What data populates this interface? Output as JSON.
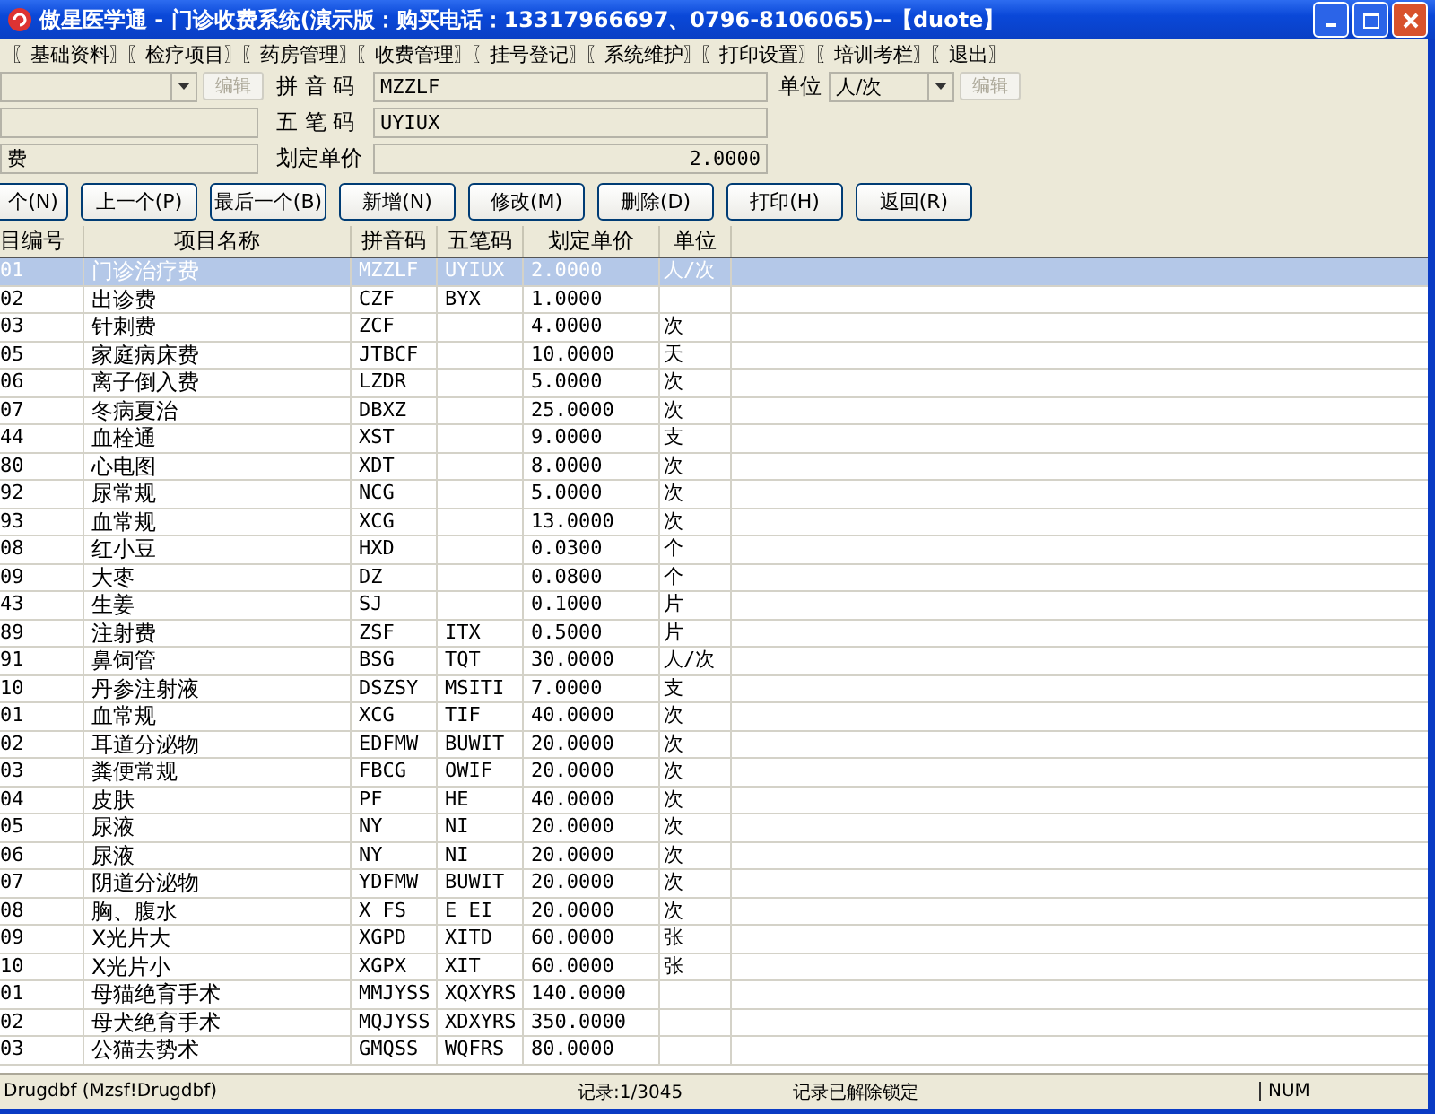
{
  "window": {
    "title": "傲星医学通 - 门诊收费系统(演示版：购买电话：13317966697、0796-8106065)--【duote】"
  },
  "menu": [
    "〖基础资料〗",
    "〖检疗项目〗",
    "〖药房管理〗",
    "〖收费管理〗",
    "〖挂号登记〗",
    "〖系统维护〗",
    "〖打印设置〗",
    "〖培训考栏〗",
    "〖退出〗"
  ],
  "form": {
    "left_fields": [
      {
        "kind": "combo",
        "button": "编辑",
        "disabled": true
      },
      {
        "kind": "text"
      },
      {
        "kind": "text",
        "value": "费"
      }
    ],
    "fields": [
      {
        "label": "拼 音 码",
        "value": "MZZLF",
        "kind": "text"
      },
      {
        "label": "五 笔 码",
        "value": "UYIUX",
        "kind": "text"
      },
      {
        "label": "划定单价",
        "value": "2.0000",
        "kind": "number"
      }
    ],
    "unit": {
      "label": "单位",
      "value": "人/次",
      "button": "编辑",
      "disabled": true
    }
  },
  "buttons": [
    "个(N)",
    "上一个(P)",
    "最后一个(B)",
    "新增(N)",
    "修改(M)",
    "删除(D)",
    "打印(H)",
    "返回(R)"
  ],
  "table": {
    "columns": [
      "目编号",
      "项目名称",
      "拼音码",
      "五笔码",
      "划定单价",
      "单位"
    ],
    "rows": [
      {
        "cells": [
          "01",
          "门诊治疗费",
          "MZZLF",
          "UYIUX",
          "2.0000",
          "人/次"
        ],
        "selected": true
      },
      {
        "cells": [
          "02",
          "出诊费",
          "CZF",
          "BYX",
          "1.0000",
          ""
        ],
        "selected": false
      },
      {
        "cells": [
          "03",
          "针刺费",
          "ZCF",
          "",
          "4.0000",
          "次"
        ],
        "selected": false
      },
      {
        "cells": [
          "05",
          "家庭病床费",
          "JTBCF",
          "",
          "10.0000",
          "天"
        ],
        "selected": false
      },
      {
        "cells": [
          "06",
          "离子倒入费",
          "LZDR",
          "",
          "5.0000",
          "次"
        ],
        "selected": false
      },
      {
        "cells": [
          "07",
          "冬病夏治",
          "DBXZ",
          "",
          "25.0000",
          "次"
        ],
        "selected": false
      },
      {
        "cells": [
          "44",
          "血栓通",
          "XST",
          "",
          "9.0000",
          "支"
        ],
        "selected": false
      },
      {
        "cells": [
          "80",
          "心电图",
          "XDT",
          "",
          "8.0000",
          "次"
        ],
        "selected": false
      },
      {
        "cells": [
          "92",
          "尿常规",
          "NCG",
          "",
          "5.0000",
          "次"
        ],
        "selected": false
      },
      {
        "cells": [
          "93",
          "血常规",
          "XCG",
          "",
          "13.0000",
          "次"
        ],
        "selected": false
      },
      {
        "cells": [
          "08",
          "红小豆",
          "HXD",
          "",
          "0.0300",
          "个"
        ],
        "selected": false
      },
      {
        "cells": [
          "09",
          "大枣",
          "DZ",
          "",
          "0.0800",
          "个"
        ],
        "selected": false
      },
      {
        "cells": [
          "43",
          "生姜",
          "SJ",
          "",
          "0.1000",
          "片"
        ],
        "selected": false
      },
      {
        "cells": [
          "89",
          "注射费",
          "ZSF",
          "ITX",
          "0.5000",
          "片"
        ],
        "selected": false
      },
      {
        "cells": [
          "91",
          "鼻饲管",
          "BSG",
          "TQT",
          "30.0000",
          "人/次"
        ],
        "selected": false
      },
      {
        "cells": [
          "10",
          "丹参注射液",
          "DSZSY",
          "MSITI",
          "7.0000",
          "支"
        ],
        "selected": false
      },
      {
        "cells": [
          "01",
          "血常规",
          "XCG",
          "TIF",
          "40.0000",
          "次"
        ],
        "selected": false
      },
      {
        "cells": [
          "02",
          "耳道分泌物",
          "EDFMW",
          "BUWIT",
          "20.0000",
          "次"
        ],
        "selected": false
      },
      {
        "cells": [
          "03",
          "粪便常规",
          "FBCG",
          "OWIF",
          "20.0000",
          "次"
        ],
        "selected": false
      },
      {
        "cells": [
          "04",
          "皮肤",
          "PF",
          "HE",
          "40.0000",
          "次"
        ],
        "selected": false
      },
      {
        "cells": [
          "05",
          "尿液",
          "NY",
          "NI",
          "20.0000",
          "次"
        ],
        "selected": false
      },
      {
        "cells": [
          "06",
          "尿液",
          "NY",
          "NI",
          "20.0000",
          "次"
        ],
        "selected": false
      },
      {
        "cells": [
          "07",
          "阴道分泌物",
          "YDFMW",
          "BUWIT",
          "20.0000",
          "次"
        ],
        "selected": false
      },
      {
        "cells": [
          "08",
          "胸、腹水",
          "X FS",
          "E EI",
          "20.0000",
          "次"
        ],
        "selected": false
      },
      {
        "cells": [
          "09",
          "X光片大",
          "XGPD",
          "XITD",
          "60.0000",
          "张"
        ],
        "selected": false
      },
      {
        "cells": [
          "10",
          "X光片小",
          "XGPX",
          "XIT",
          "60.0000",
          "张"
        ],
        "selected": false
      },
      {
        "cells": [
          "01",
          "母猫绝育手术",
          "MMJYSS",
          "XQXYRS",
          "140.0000",
          ""
        ],
        "selected": false
      },
      {
        "cells": [
          "02",
          "母犬绝育手术",
          "MQJYSS",
          "XDXYRS",
          "350.0000",
          ""
        ],
        "selected": false
      },
      {
        "cells": [
          "03",
          "公猫去势术",
          "GMQSS",
          "WQFRS",
          "80.0000",
          ""
        ],
        "selected": false
      }
    ]
  },
  "status_bar": [
    "Drugdbf (Mzsf!Drugdbf)",
    "记录:1/3045",
    "记录已解除锁定",
    "NUM"
  ]
}
